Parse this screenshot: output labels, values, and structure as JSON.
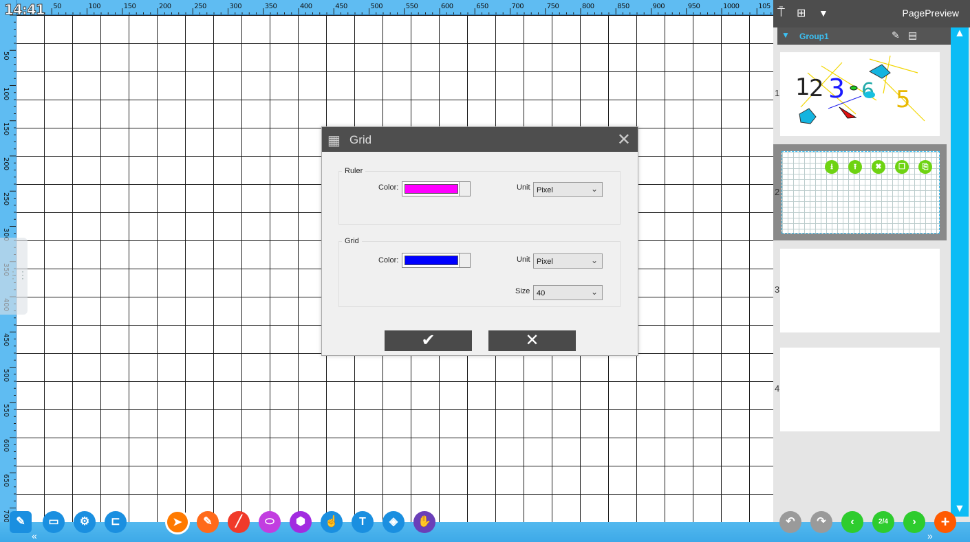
{
  "clock": "14:41",
  "ruler": {
    "top_labels": [
      "50",
      "100",
      "150",
      "200",
      "250",
      "300",
      "350",
      "400",
      "450",
      "500",
      "550",
      "600",
      "650",
      "700",
      "750",
      "800",
      "850",
      "900",
      "950",
      "1000",
      "105"
    ],
    "left_labels": [
      "50",
      "100",
      "150",
      "200",
      "250",
      "300",
      "350",
      "400",
      "450",
      "500",
      "550",
      "600",
      "650",
      "700"
    ]
  },
  "dialog": {
    "title": "Grid",
    "ruler_section": "Ruler",
    "ruler_color_label": "Color:",
    "ruler_color": "#ff00ff",
    "ruler_unit_label": "Unit",
    "ruler_unit_value": "Pixel",
    "grid_section": "Grid",
    "grid_color_label": "Color:",
    "grid_color": "#0000ff",
    "grid_unit_label": "Unit",
    "grid_unit_value": "Pixel",
    "grid_size_label": "Size",
    "grid_size_value": "40",
    "ok_glyph": "✔",
    "cancel_glyph": "✕"
  },
  "panel": {
    "title": "PagePreview",
    "group_name": "Group1",
    "pages": [
      "1",
      "2",
      "3",
      "4"
    ]
  },
  "page_indicator": "2/4",
  "colors": {
    "accent": "#0cbcf5",
    "toolbar_blue": "#1a8fe0",
    "select_tool": "#ff7a00",
    "pen_tool": "#ff6a1a",
    "line_tool": "#f03a2a",
    "eraser_tool": "#c23ee0",
    "shape_tool": "#a22be0",
    "nav_green": "#2ecc2e",
    "add_orange": "#ff5a00"
  }
}
